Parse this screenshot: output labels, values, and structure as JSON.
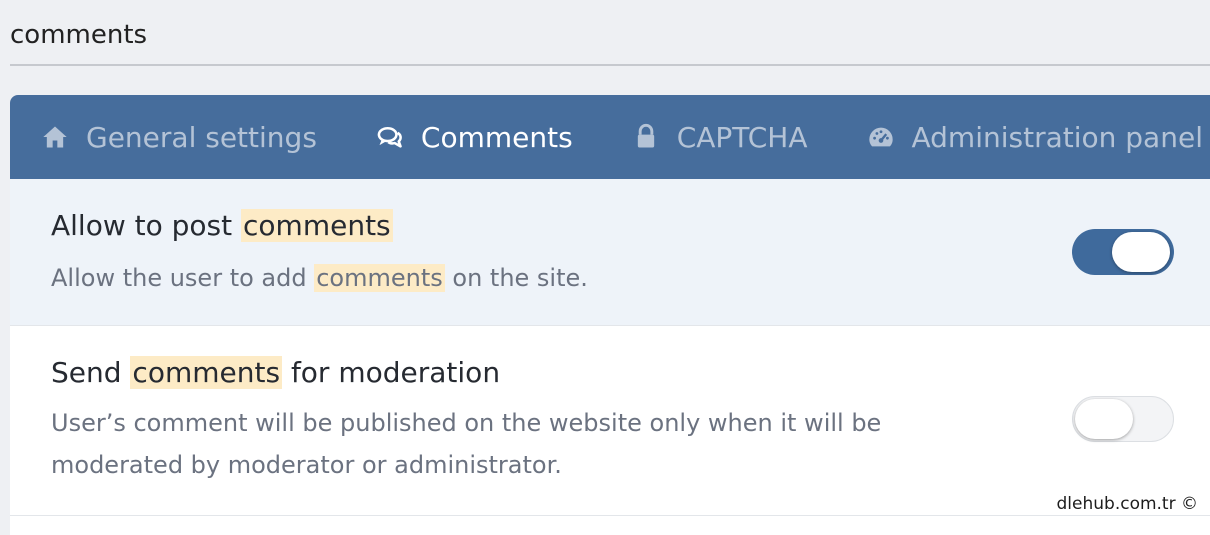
{
  "search": {
    "value": "comments"
  },
  "tabs": [
    {
      "label": "General settings",
      "icon": "home-icon",
      "active": false
    },
    {
      "label": "Comments",
      "icon": "comments-icon",
      "active": true
    },
    {
      "label": "CAPTCHA",
      "icon": "lock-icon",
      "active": false
    },
    {
      "label": "Administration panel",
      "icon": "dashboard-icon",
      "active": false
    }
  ],
  "settings": [
    {
      "title_pre": "Allow to post ",
      "title_hl": "comments",
      "title_post": "",
      "desc_pre": "Allow the user to add ",
      "desc_hl": "comments",
      "desc_post": " on the site.",
      "enabled": true
    },
    {
      "title_pre": "Send ",
      "title_hl": "comments",
      "title_post": " for moderation",
      "desc": "User’s comment will be published on the website only when it will be moderated by moderator or administrator.",
      "enabled": false
    }
  ],
  "watermark": "dlehub.com.tr ©",
  "colors": {
    "tab_bar": "#466d9c",
    "highlight": "#fdebc6",
    "toggle_on": "#3f6a9c"
  }
}
